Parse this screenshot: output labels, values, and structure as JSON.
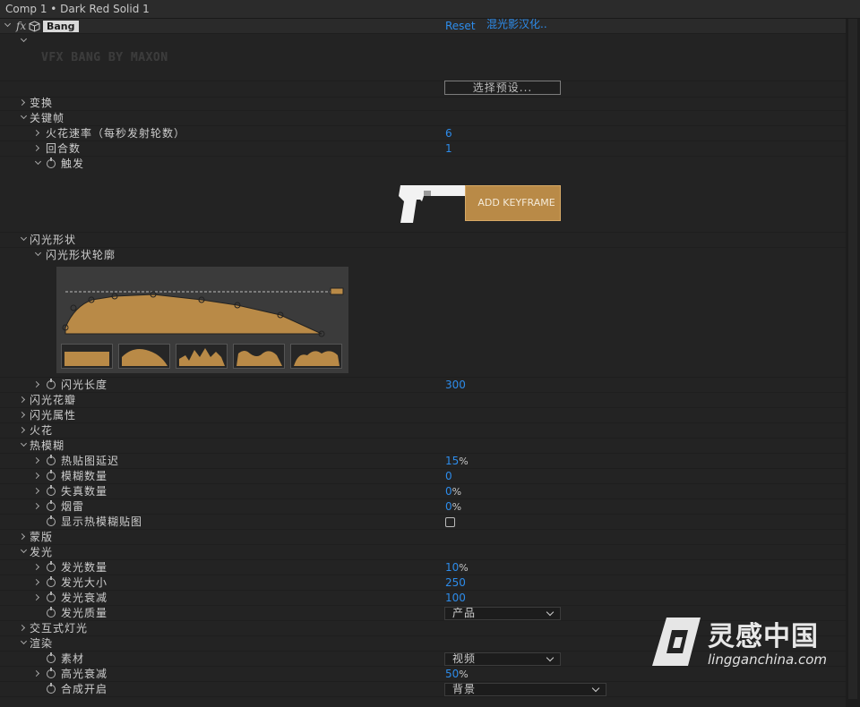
{
  "window": {
    "title": "Comp 1 • Dark Red Solid 1"
  },
  "effect": {
    "fx_label": "fx",
    "name": "Bang",
    "reset_label": "Reset",
    "credit_link": "混光影汉化..",
    "logo_text": "VFX BANG BY MAXON",
    "preset_button": "选择预设..."
  },
  "keyframe_button": {
    "label": "ADD KEYFRAME"
  },
  "accent_color": "#b98a47",
  "link_color": "#2d8ceb",
  "rows": {
    "transform": {
      "label": "变换"
    },
    "keyframes": {
      "label": "关键帧"
    },
    "spark_rate": {
      "label": "火花速率（每秒发射轮数）",
      "value": "6"
    },
    "rounds": {
      "label": "回合数",
      "value": "1"
    },
    "trigger": {
      "label": "触发"
    },
    "flash_shape": {
      "label": "闪光形状"
    },
    "flash_profile": {
      "label": "闪光形状轮廓"
    },
    "flash_length": {
      "label": "闪光长度",
      "value": "300"
    },
    "flash_petals": {
      "label": "闪光花瓣"
    },
    "flash_props": {
      "label": "闪光属性"
    },
    "sparks": {
      "label": "火花"
    },
    "heat_blur": {
      "label": "热模糊"
    },
    "heat_delay": {
      "label": "热贴图延迟",
      "value": "15",
      "unit": "%"
    },
    "blur_amount": {
      "label": "模糊数量",
      "value": "0"
    },
    "distortion": {
      "label": "失真数量",
      "value": "0",
      "unit": "%"
    },
    "smoke": {
      "label": "烟雷",
      "value": "0",
      "unit": "%"
    },
    "show_heat_map": {
      "label": "显示热模糊贴图"
    },
    "mask": {
      "label": "蒙版"
    },
    "glow": {
      "label": "发光"
    },
    "glow_amount": {
      "label": "发光数量",
      "value": "10",
      "unit": "%"
    },
    "glow_size": {
      "label": "发光大小",
      "value": "250"
    },
    "glow_falloff": {
      "label": "发光衰减",
      "value": "100"
    },
    "glow_quality": {
      "label": "发光质量",
      "dropdown": "产品"
    },
    "interactive_light": {
      "label": "交互式灯光"
    },
    "render": {
      "label": "渲染"
    },
    "source": {
      "label": "素材",
      "dropdown": "视频"
    },
    "highlight_falloff": {
      "label": "高光衰减",
      "value": "50",
      "unit": "%"
    },
    "composite_on": {
      "label": "合成开启",
      "dropdown": "背景"
    }
  },
  "watermark": {
    "brand": "灵感中国",
    "site": "lingganchina.com"
  }
}
